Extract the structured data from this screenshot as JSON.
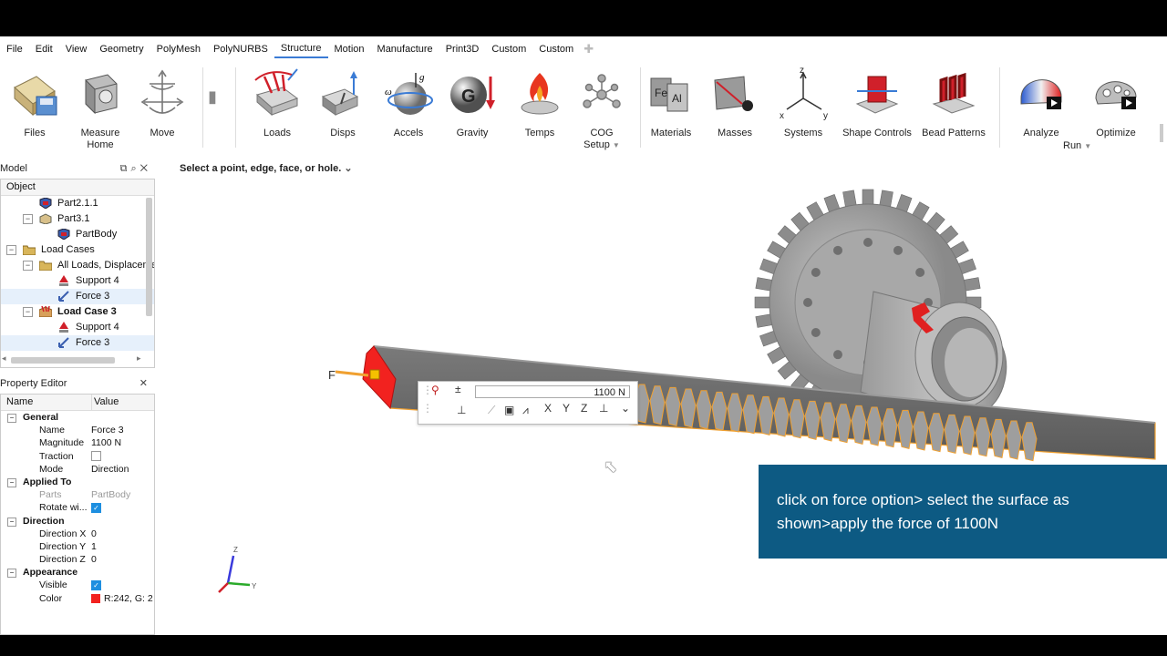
{
  "menu": [
    "File",
    "Edit",
    "View",
    "Geometry",
    "PolyMesh",
    "PolyNURBS",
    "Structure",
    "Motion",
    "Manufacture",
    "Print3D",
    "Custom",
    "Custom"
  ],
  "menu_active": "Structure",
  "ribbon": {
    "files": "Files",
    "measure_line1": "Measure",
    "measure_line2": "Home",
    "move": "Move",
    "loads": "Loads",
    "disps": "Disps",
    "accels": "Accels",
    "gravity": "Gravity",
    "temps": "Temps",
    "cog_line1": "COG",
    "cog_line2": "Setup",
    "materials": "Materials",
    "masses": "Masses",
    "systems": "Systems",
    "shape_controls": "Shape Controls",
    "bead_patterns": "Bead Patterns",
    "analyze": "Analyze",
    "run": "Run",
    "optimize": "Optimize",
    "icon_glyphs": {
      "accels_g": "g",
      "accels_w": "ω",
      "gravity_g": "G",
      "materials_fe": "Fe",
      "materials_al": "Al",
      "systems_z": "z",
      "systems_x": "x",
      "systems_y": "y"
    }
  },
  "model_panel": {
    "title": "Model",
    "column": "Object",
    "rows": [
      {
        "label": "Part2.1.1"
      },
      {
        "label": "Part3.1"
      },
      {
        "label": "PartBody"
      },
      {
        "label": "Load Cases"
      },
      {
        "label": "All Loads, Displaceme"
      },
      {
        "label": "Support 4"
      },
      {
        "label": "Force 3"
      },
      {
        "label": "Load Case 3"
      },
      {
        "label": "Support 4"
      },
      {
        "label": "Force 3"
      }
    ]
  },
  "property_editor": {
    "title": "Property Editor",
    "col_name": "Name",
    "col_value": "Value",
    "groups": {
      "general": "General",
      "applied_to": "Applied To",
      "direction": "Direction",
      "appearance": "Appearance"
    },
    "rows": {
      "name_label": "Name",
      "name_value": "Force 3",
      "magnitude_label": "Magnitude",
      "magnitude_value": "1100 N",
      "traction_label": "Traction",
      "mode_label": "Mode",
      "mode_value": "Direction",
      "parts_label": "Parts",
      "parts_value": "PartBody",
      "rotate_label": "Rotate wi...",
      "dirx_label": "Direction X",
      "dirx_value": "0",
      "diry_label": "Direction Y",
      "diry_value": "1",
      "dirz_label": "Direction Z",
      "dirz_value": "0",
      "visible_label": "Visible",
      "color_label": "Color",
      "color_value": "R:242, G: 2"
    },
    "checks": {
      "traction": false,
      "rotate": true,
      "visible": true
    }
  },
  "viewport": {
    "hint": "Select a point, edge, face, or hole.",
    "force_label": "F",
    "float_value": "1100 N",
    "float_axes": [
      "X",
      "Y",
      "Z"
    ],
    "triad": {
      "z": "Z",
      "y": "Y"
    }
  },
  "caption": "click on force option> select the surface as shown>apply the force of 1100N",
  "colors": {
    "accent": "#3a7bd5",
    "caption_bg": "#0d5a83",
    "force_red": "#f2221f",
    "edge_orange": "#f0a030"
  }
}
